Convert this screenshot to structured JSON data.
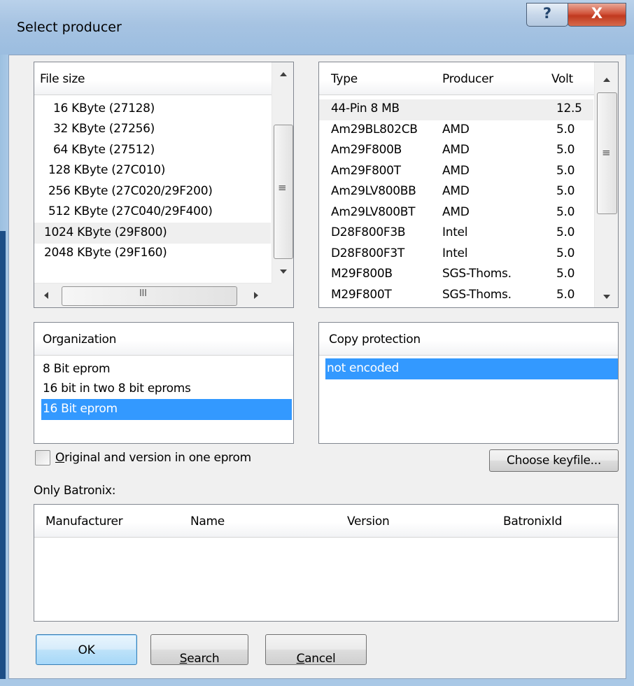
{
  "window": {
    "title": "Select producer",
    "help_glyph": "?",
    "close_glyph": "X"
  },
  "file_size": {
    "header": "File size",
    "items": [
      "16 KByte (27128)",
      "32 KByte (27256)",
      "64 KByte (27512)",
      "128 KByte (27C010)",
      "256 KByte (27C020/29F200)",
      "512 KByte (27C040/29F400)",
      "1024 KByte (29F800)",
      "2048 KByte (29F160)"
    ],
    "hscroll_grip": "III"
  },
  "producers": {
    "headers": [
      "Type",
      "Producer",
      "Volt"
    ],
    "rows": [
      [
        "44-Pin 8 MB",
        "",
        "12.5"
      ],
      [
        "Am29BL802CB",
        "AMD",
        "5.0"
      ],
      [
        "Am29F800B",
        "AMD",
        "5.0"
      ],
      [
        "Am29F800T",
        "AMD",
        "5.0"
      ],
      [
        "Am29LV800BB",
        "AMD",
        "5.0"
      ],
      [
        "Am29LV800BT",
        "AMD",
        "5.0"
      ],
      [
        "D28F800F3B",
        "Intel",
        "5.0"
      ],
      [
        "D28F800F3T",
        "Intel",
        "5.0"
      ],
      [
        "M29F800B",
        "SGS-Thoms.",
        "5.0"
      ],
      [
        "M29F800T",
        "SGS-Thoms.",
        "5.0"
      ]
    ],
    "scroll_grip": "≡"
  },
  "organization": {
    "header": "Organization",
    "items": [
      "8 Bit eprom",
      "16 bit in two 8 bit eproms",
      "16 Bit eprom"
    ],
    "selected": "16 Bit eprom"
  },
  "copy_protection": {
    "header": "Copy protection",
    "items": [
      "not encoded"
    ],
    "selected": "not encoded"
  },
  "options": {
    "original_checkbox_label": "Original and version in one eprom",
    "original_checked": false
  },
  "keyfile_button": "Choose keyfile...",
  "batronix": {
    "label": "Only Batronix:",
    "headers": [
      "Manufacturer",
      "Name",
      "Version",
      "BatronixId"
    ]
  },
  "buttons": {
    "ok": "OK",
    "search": "Search",
    "cancel": "Cancel"
  }
}
